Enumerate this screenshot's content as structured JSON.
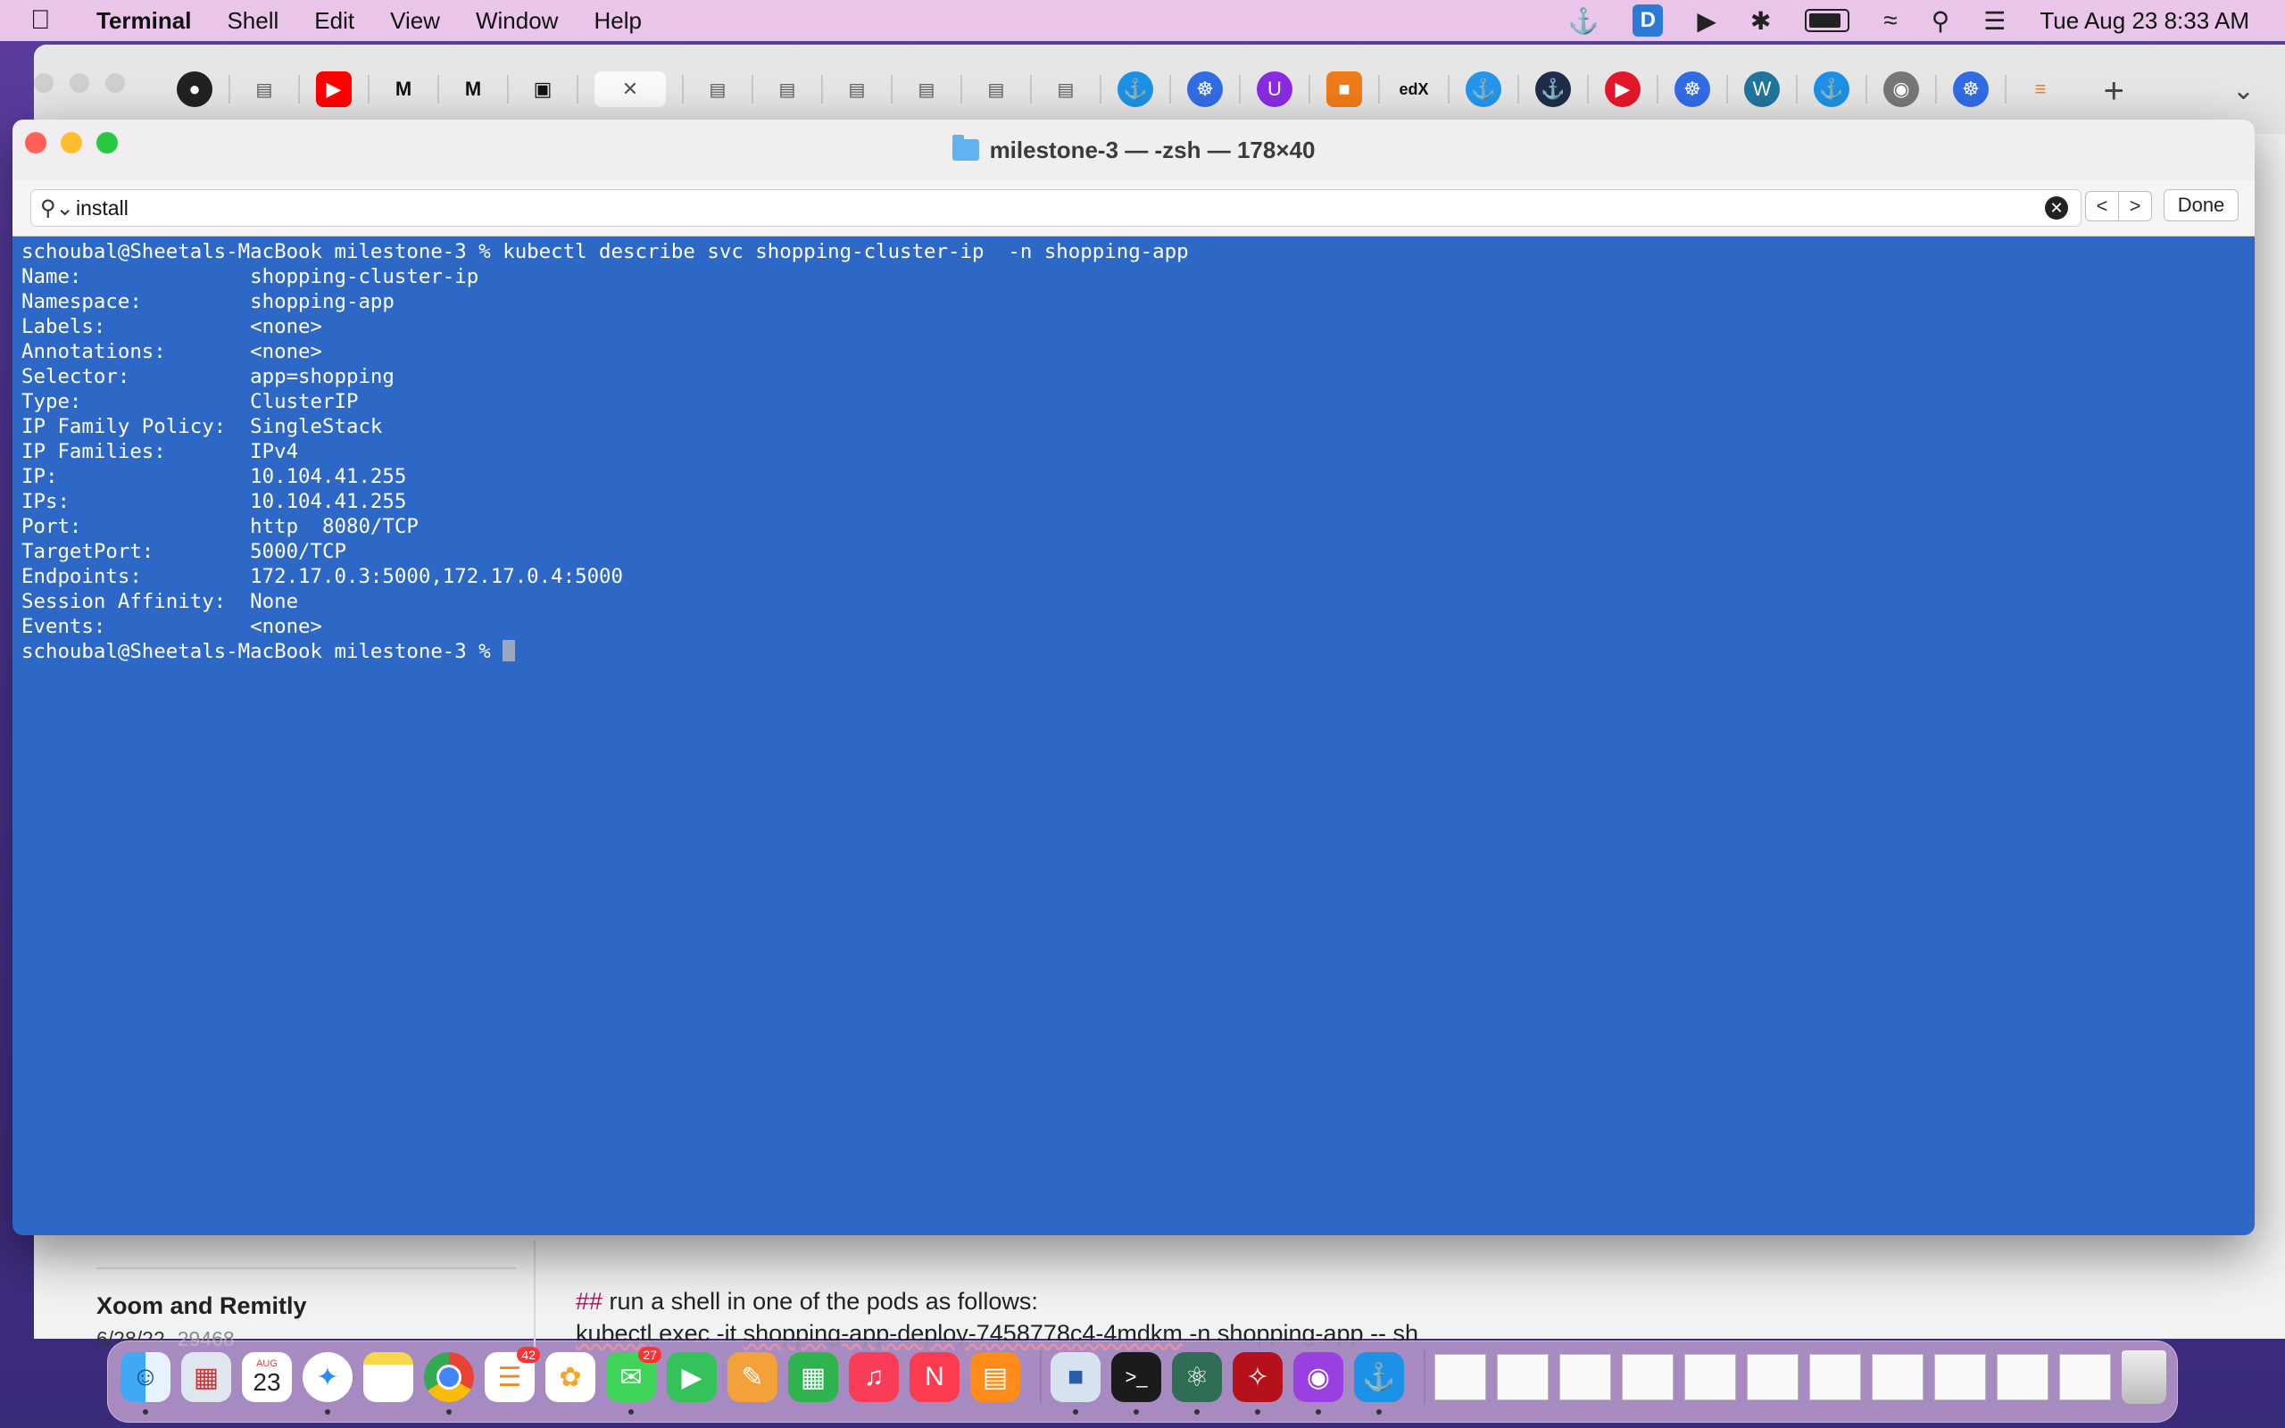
{
  "menubar": {
    "app_name": "Terminal",
    "menus": [
      "Shell",
      "Edit",
      "View",
      "Window",
      "Help"
    ],
    "datetime": "Tue Aug 23  8:33 AM",
    "icons": [
      "docker-icon",
      "d-app-icon",
      "play-circle-icon",
      "bluetooth-icon",
      "battery-icon",
      "wifi-icon",
      "search-icon",
      "control-center-icon"
    ]
  },
  "browser": {
    "tab_icons": [
      "github-icon",
      "reader-icon",
      "youtube-icon",
      "medium-icon",
      "medium-icon",
      "book-icon",
      "active-tab",
      "reader-icon",
      "reader-icon",
      "reader-icon",
      "reader-icon",
      "reader-icon",
      "reader-icon",
      "docker-icon",
      "kubernetes-icon",
      "u-icon",
      "box-icon",
      "edx-icon",
      "docker-icon",
      "docker-icon",
      "play-icon",
      "kubernetes-icon",
      "wordpress-icon",
      "docker-icon",
      "globe-icon",
      "kubernetes-icon",
      "stackoverflow-icon"
    ],
    "note_card": {
      "title": "Xoom and Remitly",
      "date": "6/28/22",
      "count": "29468"
    },
    "note_lines": {
      "hash": "##",
      "line1": " run a shell in one of the pods as follows:",
      "cmd_a": "kubectl",
      "cmd_b": " exec -it ",
      "cmd_c": "shopping-app-deploy-7458778c4-4mdkm",
      "cmd_d": " -n shopping-app -- sh"
    }
  },
  "terminal": {
    "title": "milestone-3 — -zsh — 178×40",
    "find": {
      "query": "install",
      "done_label": "Done",
      "prev_glyph": "<",
      "next_glyph": ">"
    },
    "lines": [
      "schoubal@Sheetals-MacBook milestone-3 % kubectl describe svc shopping-cluster-ip  -n shopping-app",
      "Name:              shopping-cluster-ip",
      "Namespace:         shopping-app",
      "Labels:            <none>",
      "Annotations:       <none>",
      "Selector:          app=shopping",
      "Type:              ClusterIP",
      "IP Family Policy:  SingleStack",
      "IP Families:       IPv4",
      "IP:                10.104.41.255",
      "IPs:               10.104.41.255",
      "Port:              http  8080/TCP",
      "TargetPort:        5000/TCP",
      "Endpoints:         172.17.0.3:5000,172.17.0.4:5000",
      "Session Affinity:  None",
      "Events:            <none>"
    ],
    "prompt": "schoubal@Sheetals-MacBook milestone-3 % "
  },
  "dock": {
    "date_month": "AUG",
    "date_day": "23",
    "reminders_badge": "42",
    "messages_badge": "27",
    "apps": [
      "finder-icon",
      "launchpad-icon",
      "calendar-icon",
      "safari-icon",
      "notes-icon",
      "chrome-icon",
      "reminders-icon",
      "photos-icon",
      "messages-icon",
      "facetime-icon",
      "pages-icon",
      "numbers-icon",
      "music-icon",
      "news-icon",
      "books-icon",
      "virtualbox-icon",
      "terminal-icon",
      "atom-icon",
      "acrobat-icon",
      "podcasts-icon",
      "docker-icon"
    ]
  },
  "colors": {
    "terminal_bg": "#2e68c7",
    "menubar_bg": "#e9c6e9"
  }
}
